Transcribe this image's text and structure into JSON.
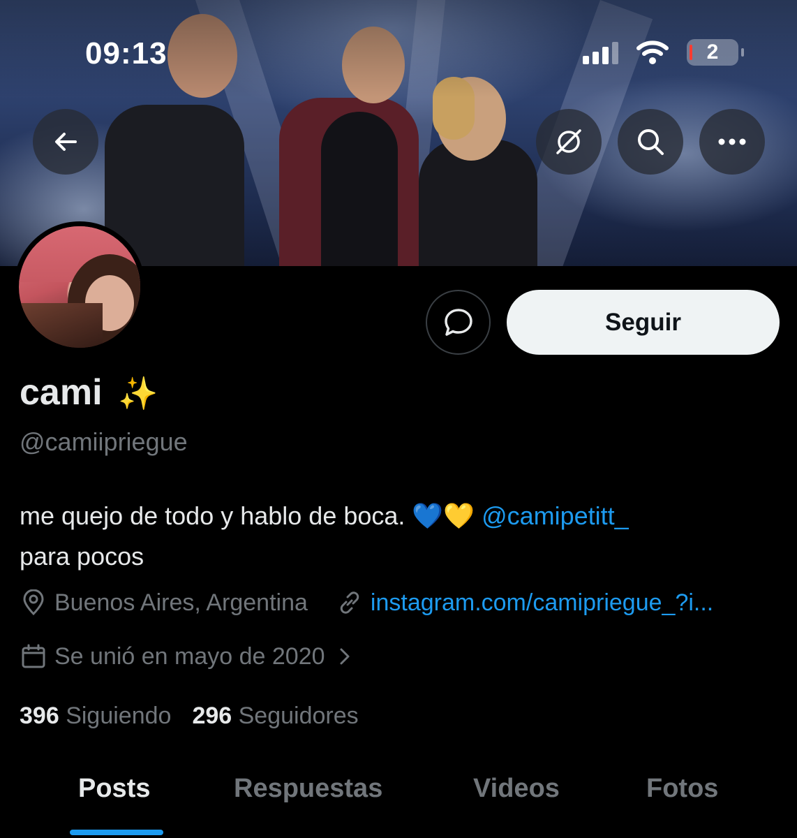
{
  "status_bar": {
    "time": "09:13",
    "battery": "2"
  },
  "header": {
    "back_icon": "arrow-left-icon",
    "translate_icon": "globe-slash-icon",
    "search_icon": "search-icon",
    "more_icon": "more-horizontal-icon"
  },
  "profile": {
    "name": "cami",
    "name_emoji": "✨",
    "handle": "@camiipriegue",
    "bio_text": "me quejo de todo y hablo de boca. 💙💛 ",
    "bio_mention": "@camipetitt_",
    "bio_line2": "para pocos",
    "location": "Buenos Aires, Argentina",
    "website": "instagram.com/camipriegue_?i...",
    "joined": "Se unió en mayo de 2020",
    "following_count": "396",
    "following_label": "Siguiendo",
    "followers_count": "296",
    "followers_label": "Seguidores"
  },
  "actions": {
    "follow_label": "Seguir"
  },
  "tabs": [
    {
      "label": "Posts",
      "active": true
    },
    {
      "label": "Respuestas",
      "active": false
    },
    {
      "label": "Videos",
      "active": false
    },
    {
      "label": "Fotos",
      "active": false
    }
  ],
  "colors": {
    "accent": "#1d9bf0",
    "background": "#000000",
    "muted": "#71767b",
    "text": "#e7e9ea"
  }
}
